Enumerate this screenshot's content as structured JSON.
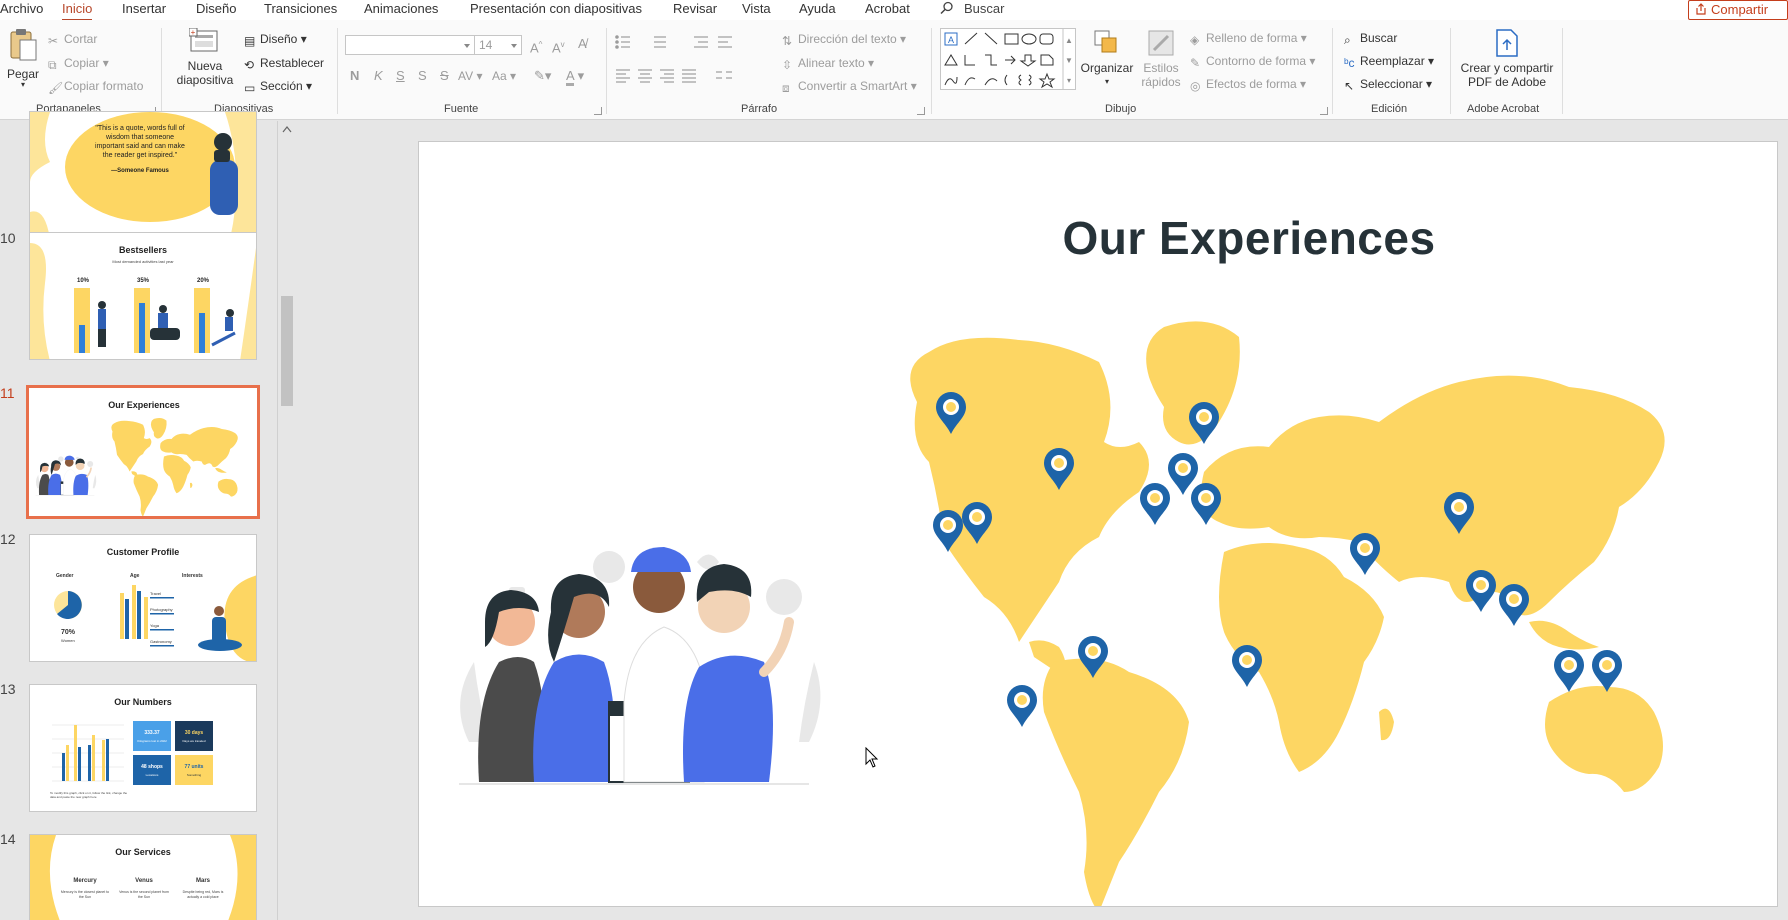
{
  "menubar": {
    "tabs": [
      "Archivo",
      "Inicio",
      "Insertar",
      "Diseño",
      "Transiciones",
      "Animaciones",
      "Presentación con diapositivas",
      "Revisar",
      "Vista",
      "Ayuda",
      "Acrobat"
    ],
    "active_tab": "Inicio",
    "search_label": "Buscar",
    "share_label": "Compartir"
  },
  "ribbon": {
    "clipboard": {
      "paste": "Pegar",
      "cut": "Cortar",
      "copy": "Copiar",
      "format_painter": "Copiar formato",
      "label": "Portapapeles"
    },
    "slides": {
      "new_slide_1": "Nueva",
      "new_slide_2": "diapositiva",
      "layout": "Diseño",
      "reset": "Restablecer",
      "section": "Sección",
      "label": "Diapositivas"
    },
    "font": {
      "font_name": "",
      "font_size": "14",
      "bold": "N",
      "italic": "K",
      "underline": "S",
      "strike": "S",
      "spacing": "AV",
      "case": "Aa",
      "label": "Fuente"
    },
    "paragraph": {
      "text_direction": "Dirección del texto",
      "align_text": "Alinear texto",
      "smartart": "Convertir a SmartArt",
      "label": "Párrafo"
    },
    "drawing": {
      "arrange": "Organizar",
      "quick_styles_1": "Estilos",
      "quick_styles_2": "rápidos",
      "shape_fill": "Relleno de forma",
      "shape_outline": "Contorno de forma",
      "shape_effects": "Efectos de forma",
      "label": "Dibujo"
    },
    "editing": {
      "find": "Buscar",
      "replace": "Reemplazar",
      "select": "Seleccionar",
      "label": "Edición"
    },
    "acrobat": {
      "create_1": "Crear y compartir",
      "create_2": "PDF de Adobe",
      "label": "Adobe Acrobat"
    }
  },
  "thumbnails": [
    {
      "num": "",
      "title": "",
      "quote": "\"This is a quote, words full of wisdom that someone important said and can make the reader get inspired.\"",
      "author": "—Someone Famous"
    },
    {
      "num": "10",
      "title": "Bestsellers",
      "subtitle": "Most demanded activities last year",
      "bars": [
        {
          "label": "10%"
        },
        {
          "label": "35%"
        },
        {
          "label": "20%"
        }
      ]
    },
    {
      "num": "11",
      "title": "Our Experiences"
    },
    {
      "num": "12",
      "title": "Customer Profile",
      "cols": [
        "Gender",
        "Age",
        "Interests"
      ],
      "stat": "70%",
      "stat_label": "Women",
      "interests": [
        "Travel",
        "Photography",
        "Yoga",
        "Gastronomy"
      ]
    },
    {
      "num": "13",
      "title": "Our Numbers",
      "boxes": [
        {
          "v": "333.37",
          "t": "Kilograms lost in 2022"
        },
        {
          "v": "30 days",
          "t": "Days we traveled"
        },
        {
          "v": "48 shops",
          "t": "Locations"
        },
        {
          "v": "77 units",
          "t": "Something"
        }
      ],
      "note": "To modify this graph, click on it, follow the link, change the data and paste the new graph here"
    },
    {
      "num": "14",
      "title": "Our Services",
      "cols": [
        {
          "h": "Mercury",
          "t": "Mercury is the closest planet to the Sun"
        },
        {
          "h": "Venus",
          "t": "Venus is the second planet from the Sun"
        },
        {
          "h": "Mars",
          "t": "Despite being red, Mars is actually a cold place"
        }
      ]
    }
  ],
  "slide": {
    "title": "Our Experiences"
  },
  "colors": {
    "accent": "#c43e1c",
    "map": "#fdd663",
    "pin": "#1e64a8",
    "dark": "#263238",
    "blue": "#4a6ee8"
  }
}
